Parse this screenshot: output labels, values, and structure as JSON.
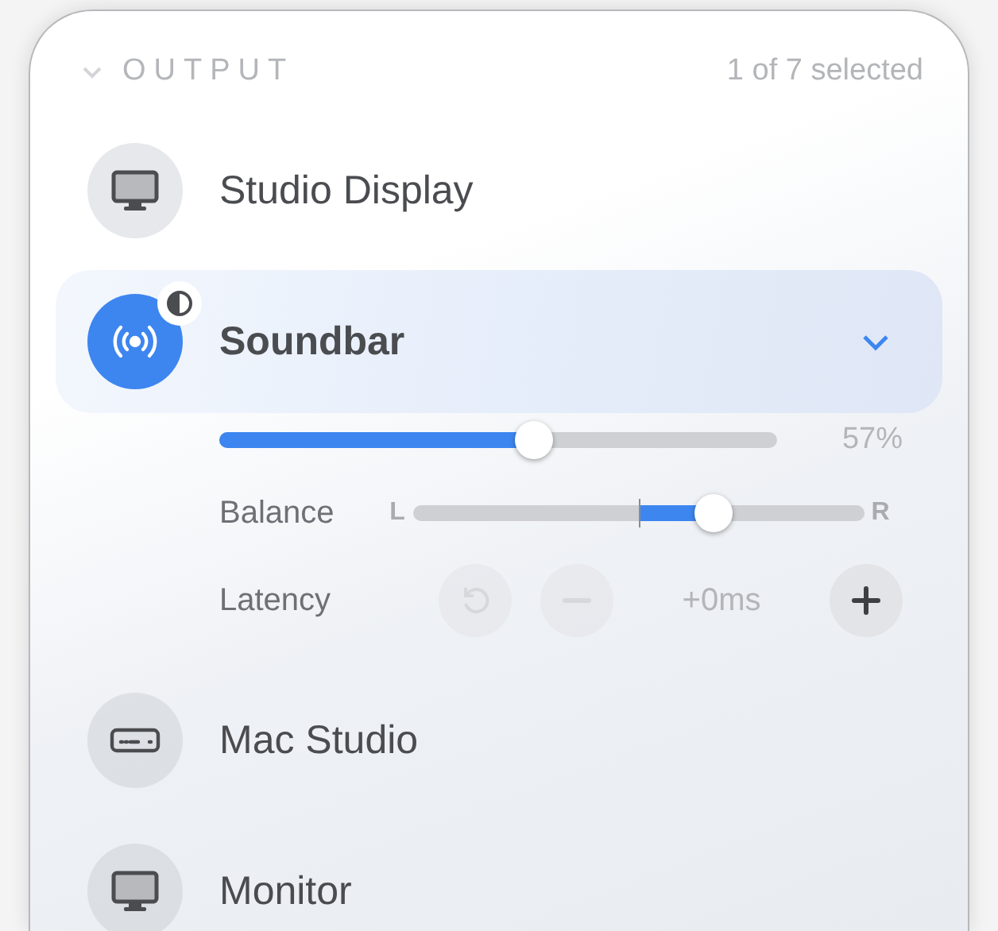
{
  "section": {
    "title": "OUTPUT",
    "expanded": true,
    "summary": "1 of 7 selected"
  },
  "devices": [
    {
      "name": "Studio Display",
      "kind": "display",
      "selected": false
    },
    {
      "name": "Soundbar",
      "kind": "speaker",
      "selected": true,
      "expanded": true,
      "badge": true,
      "settings": {
        "volume": {
          "level": 0.57,
          "reading": "57%"
        },
        "balance": {
          "label": "Balance",
          "left": "L",
          "right": "R",
          "level": 0.68
        },
        "latency": {
          "label": "Latency",
          "value": "+0ms",
          "reset_disabled": true,
          "minus_disabled": true,
          "plus_disabled": false
        }
      }
    },
    {
      "name": "Mac Studio",
      "kind": "mini",
      "selected": false
    },
    {
      "name": "Monitor",
      "kind": "display",
      "selected": false
    }
  ]
}
